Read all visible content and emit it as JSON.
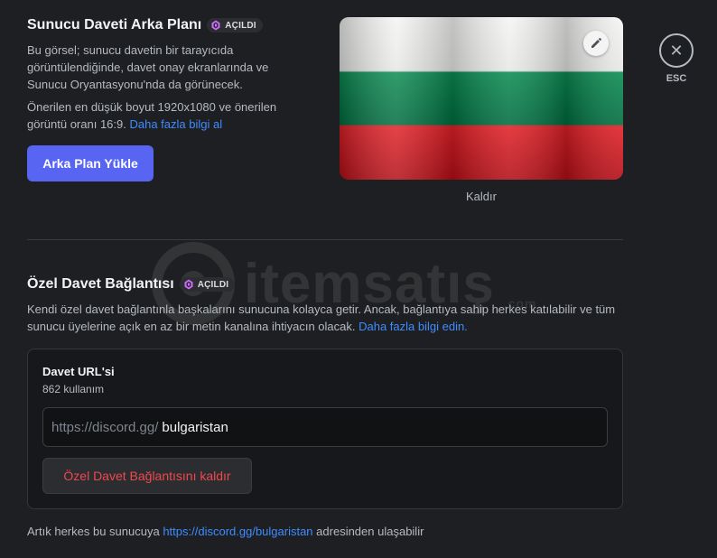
{
  "background_section": {
    "title": "Sunucu Daveti Arka Planı",
    "badge": "AÇILDI",
    "description": "Bu görsel; sunucu davetin bir tarayıcıda görüntülendiğinde, davet onay ekranlarında ve Sunucu Oryantasyonu'nda da görünecek.",
    "size_info": "Önerilen en düşük boyut 1920x1080 ve önerilen görüntü oranı 16:9.",
    "learn_more": "Daha fazla bilgi al",
    "upload_button": "Arka Plan Yükle",
    "remove_label": "Kaldır"
  },
  "close": {
    "symbol": "✕",
    "label": "ESC"
  },
  "vanity_section": {
    "title": "Özel Davet Bağlantısı",
    "badge": "AÇILDI",
    "description": "Kendi özel davet bağlantınla başkalarını sunucuna kolayca getir. Ancak, bağlantıya sahip herkes katılabilir ve tüm sunucu üyelerine açık en az bir metin kanalına ihtiyacın olacak.",
    "learn_more": "Daha fazla bilgi edin.",
    "card": {
      "label": "Davet URL'si",
      "usage": "862 kullanım",
      "url_prefix": "https://discord.gg/",
      "url_value": "bulgaristan",
      "remove_button": "Özel Davet Bağlantısını kaldır"
    },
    "footer_prefix": "Artık herkes bu sunucuya",
    "footer_link": "https://discord.gg/bulgaristan",
    "footer_suffix": "adresinden ulaşabilir"
  },
  "watermark": {
    "text": "itemsatış",
    "suffix": ".com"
  },
  "colors": {
    "accent": "#5865f2",
    "link": "#3f8cff",
    "danger": "#f0484d",
    "background": "#1e1f22",
    "boost_gem": "#d36bff"
  }
}
